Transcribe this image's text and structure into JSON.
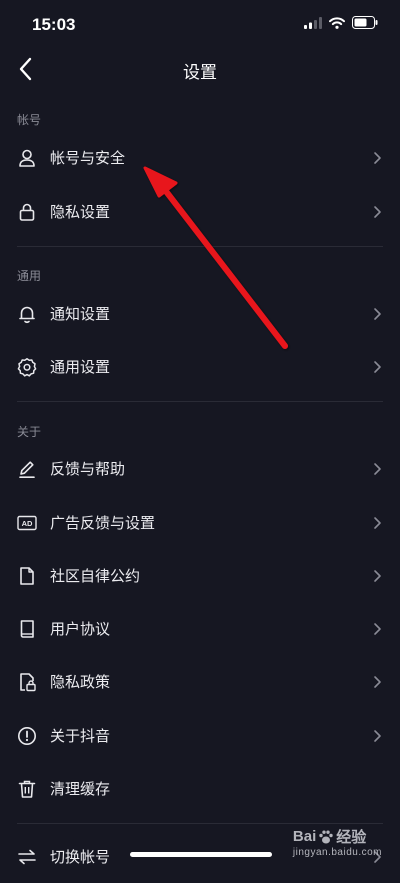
{
  "status": {
    "time": "15:03"
  },
  "header": {
    "title": "设置"
  },
  "sections": {
    "account": {
      "title": "帐号",
      "items": [
        "帐号与安全",
        "隐私设置"
      ]
    },
    "general": {
      "title": "通用",
      "items": [
        "通知设置",
        "通用设置"
      ]
    },
    "about": {
      "title": "关于",
      "items": [
        "反馈与帮助",
        "广告反馈与设置",
        "社区自律公约",
        "用户协议",
        "隐私政策",
        "关于抖音",
        "清理缓存"
      ]
    },
    "bottom": {
      "items": [
        "切换帐号"
      ]
    }
  },
  "icons": {
    "account_security": "user-icon",
    "privacy_settings": "lock-icon",
    "notification": "bell-icon",
    "general": "gear-icon",
    "feedback": "pencil-icon",
    "ad": "ad-icon",
    "community": "document-icon",
    "agreement": "book-icon",
    "privacy_policy": "file-lock-icon",
    "about": "info-icon",
    "cache": "trash-icon",
    "switch": "switch-icon"
  },
  "ad_badge": "AD",
  "watermark": {
    "brand": "Bai",
    "brand_suffix": "经验",
    "url": "jingyan.baidu.com"
  },
  "colors": {
    "background": "#161722",
    "annotation_arrow": "#e8141c"
  }
}
